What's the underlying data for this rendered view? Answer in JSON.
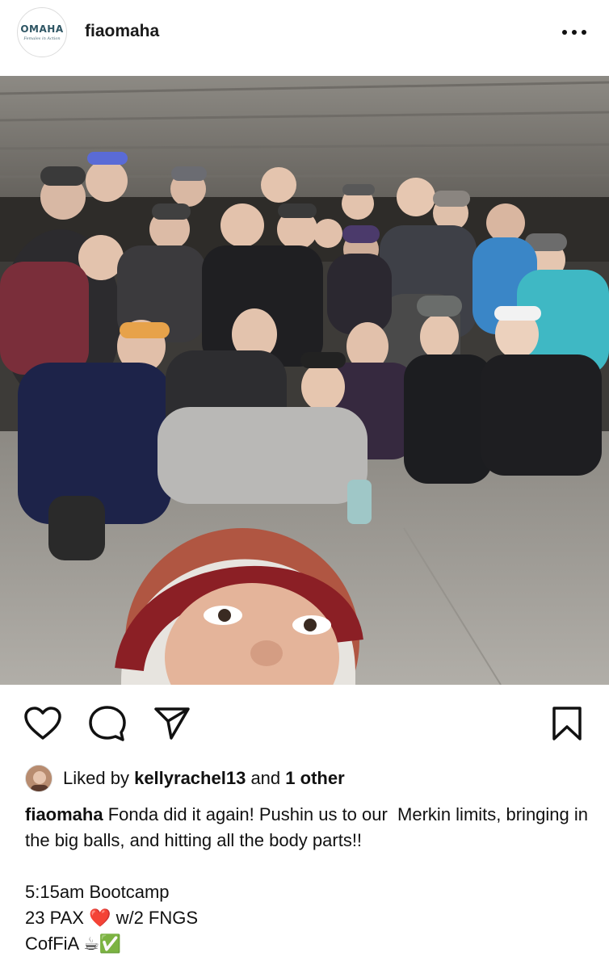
{
  "post": {
    "username": "fiaomaha",
    "avatar_logo": {
      "line1": "OMAHA",
      "line2": "Females in Action"
    },
    "more_icon": "more-horizontal-icon"
  },
  "actions": {
    "icons": [
      "heart-icon",
      "comment-icon",
      "share-icon",
      "bookmark-icon"
    ]
  },
  "likes": {
    "prefix": "Liked by ",
    "user": "kellyrachel13",
    "middle": " and ",
    "others": "1 other"
  },
  "caption": {
    "author": "fiaomaha",
    "text": " Fonda did it again! Pushin us to our  Merkin limits, bringing in the big balls, and hitting all the body parts!!",
    "line1": "5:15am Bootcamp",
    "line2": "23 PAX ❤️ w/2 FNGS",
    "line3": "CofFiA ☕✅"
  },
  "colors": {
    "text": "#111111",
    "photo_bg": "#3d3b38",
    "floor": "#a8a59f"
  }
}
